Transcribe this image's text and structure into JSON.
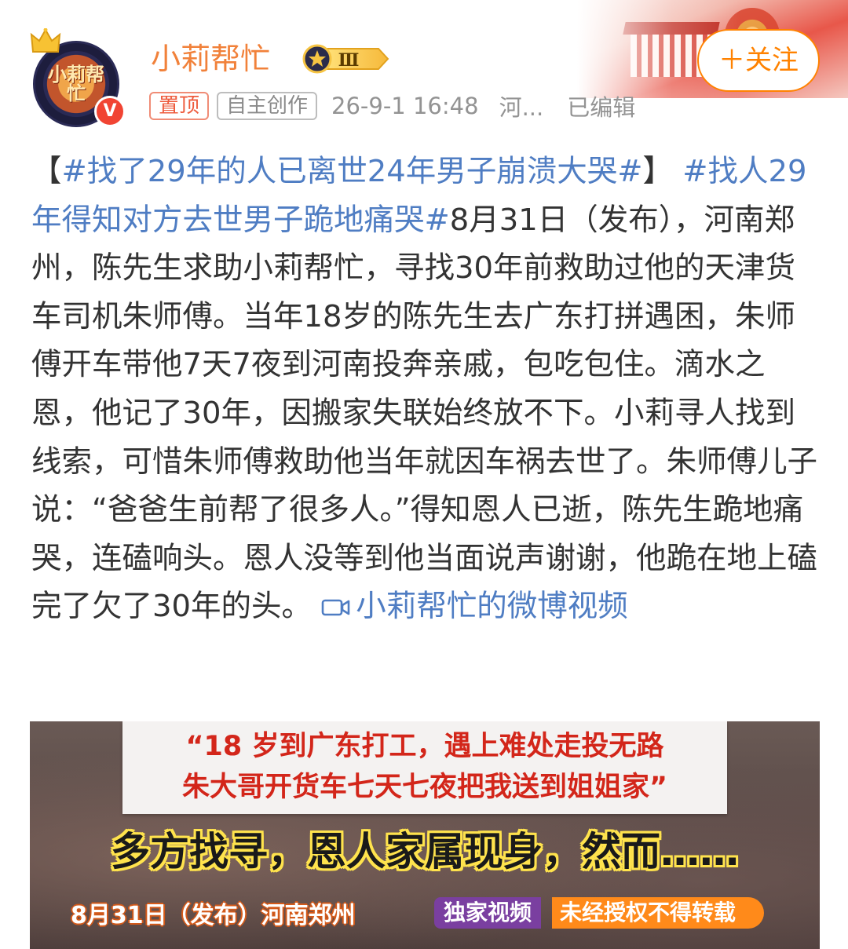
{
  "user": {
    "name": "小莉帮忙",
    "avatar_text": "小莉帮忙",
    "vip_level": "Ⅲ",
    "verified_mark": "V"
  },
  "meta": {
    "pinned_tag": "置顶",
    "original_tag": "自主创作",
    "time": "26-9-1 16:48",
    "location": "河...",
    "edited": "已编辑"
  },
  "follow_button": {
    "label": "＋关注"
  },
  "post": {
    "open_bracket": "【",
    "hashtag_1": "#找了29年的人已离世24年男子崩溃大哭#",
    "close_bracket": "】",
    "hashtag_2": "#找人29年得知对方去世男子跪地痛哭#",
    "body": "8月31日（发布），河南郑州，陈先生求助小莉帮忙，寻找30年前救助过他的天津货车司机朱师傅。当年18岁的陈先生去广东打拼遇困，朱师傅开车带他7天7夜到河南投奔亲戚，包吃包住。滴水之恩，他记了30年，因搬家失联始终放不下。小莉寻人找到线索，可惜朱师傅救助他当年就因车祸去世了。朱师傅儿子说：“爸爸生前帮了很多人。”得知恩人已逝，陈先生跪地痛哭，连磕响头。恩人没等到他当面说声谢谢，他跪在地上磕完了欠了30年的头。",
    "video_link": "小莉帮忙的微博视频"
  },
  "video": {
    "quote_line_1": "“18 岁到广东打工，遇上难处走投无路",
    "quote_line_2": "朱大哥开货车七天七夜把我送到姐姐家”",
    "headline": "多方找寻，恩人家属现身，然而……",
    "date_location": "8月31日（发布）河南郑州",
    "exclusive_badge": "独家视频",
    "copyright_notice": "未经授权不得转载"
  },
  "colors": {
    "accent_orange": "#ff8200",
    "username_orange": "#f1813a",
    "link_blue": "#4f7dc3",
    "text_main": "#333333",
    "text_meta": "#939393"
  },
  "icons": [
    "crown-icon",
    "verified-icon",
    "vip-level-badge-icon",
    "video-camera-icon"
  ]
}
